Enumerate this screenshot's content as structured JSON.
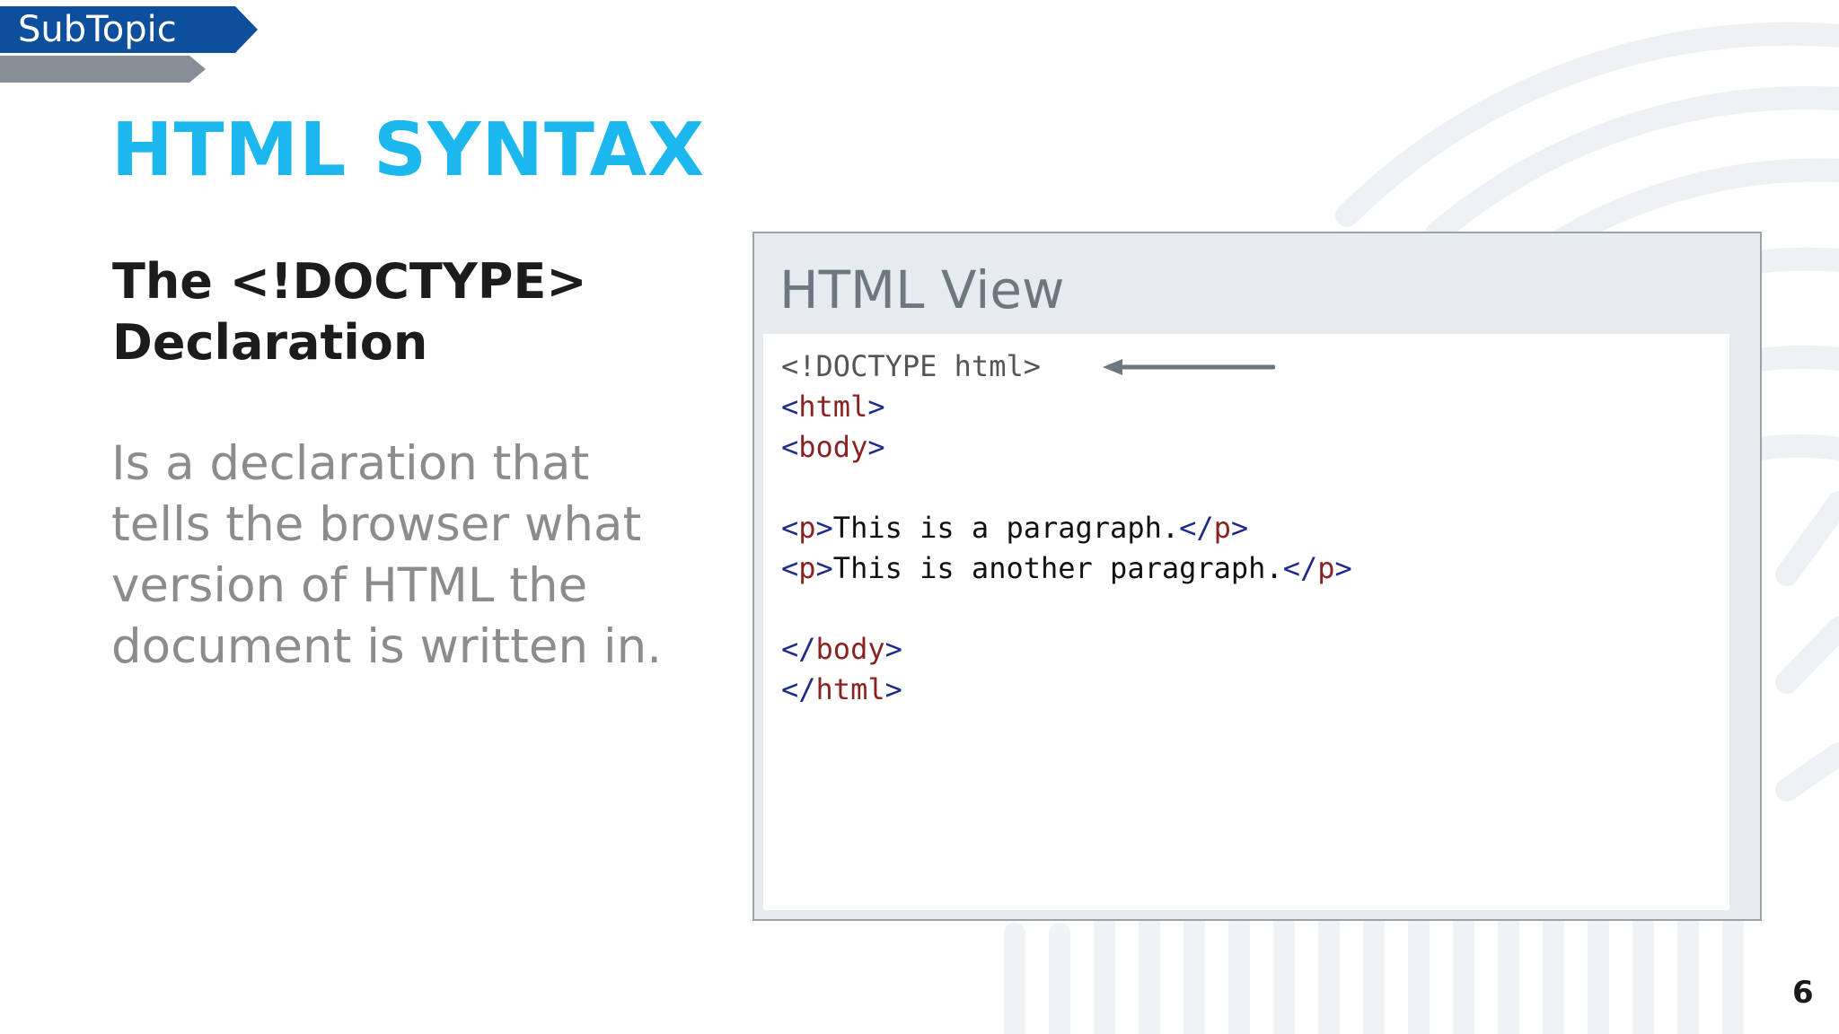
{
  "header": {
    "subtopic_label": "SubTopic",
    "slide_title": "HTML SYNTAX"
  },
  "content": {
    "heading_line1": "The <!DOCTYPE>",
    "heading_line2": "Declaration",
    "body_lines": [
      "Is a declaration that",
      "tells the browser what",
      "version of HTML the",
      "document is written in."
    ]
  },
  "code_panel": {
    "title": "HTML View",
    "lines": [
      [
        {
          "t": "doctype",
          "v": "<!DOCTYPE html>"
        }
      ],
      [
        {
          "t": "bracket",
          "v": "<"
        },
        {
          "t": "tag",
          "v": "html"
        },
        {
          "t": "bracket",
          "v": ">"
        }
      ],
      [
        {
          "t": "bracket",
          "v": "<"
        },
        {
          "t": "tag",
          "v": "body"
        },
        {
          "t": "bracket",
          "v": ">"
        }
      ],
      [],
      [
        {
          "t": "bracket",
          "v": "<"
        },
        {
          "t": "tag",
          "v": "p"
        },
        {
          "t": "bracket",
          "v": ">"
        },
        {
          "t": "text",
          "v": "This is a paragraph."
        },
        {
          "t": "bracket",
          "v": "</"
        },
        {
          "t": "tag",
          "v": "p"
        },
        {
          "t": "bracket",
          "v": ">"
        }
      ],
      [
        {
          "t": "bracket",
          "v": "<"
        },
        {
          "t": "tag",
          "v": "p"
        },
        {
          "t": "bracket",
          "v": ">"
        },
        {
          "t": "text",
          "v": "This is another paragraph."
        },
        {
          "t": "bracket",
          "v": "</"
        },
        {
          "t": "tag",
          "v": "p"
        },
        {
          "t": "bracket",
          "v": ">"
        }
      ],
      [],
      [
        {
          "t": "bracket",
          "v": "</"
        },
        {
          "t": "tag",
          "v": "body"
        },
        {
          "t": "bracket",
          "v": ">"
        }
      ],
      [
        {
          "t": "bracket",
          "v": "</"
        },
        {
          "t": "tag",
          "v": "html"
        },
        {
          "t": "bracket",
          "v": ">"
        }
      ]
    ]
  },
  "footer": {
    "page_number": "6"
  },
  "colors": {
    "title_accent": "#1ab8ee",
    "ribbon_blue": "#0d4f9c",
    "ribbon_gray": "#878d96",
    "arrow": "#6e7680"
  },
  "icons": {
    "doctype_pointer": "arrow-left-icon"
  }
}
